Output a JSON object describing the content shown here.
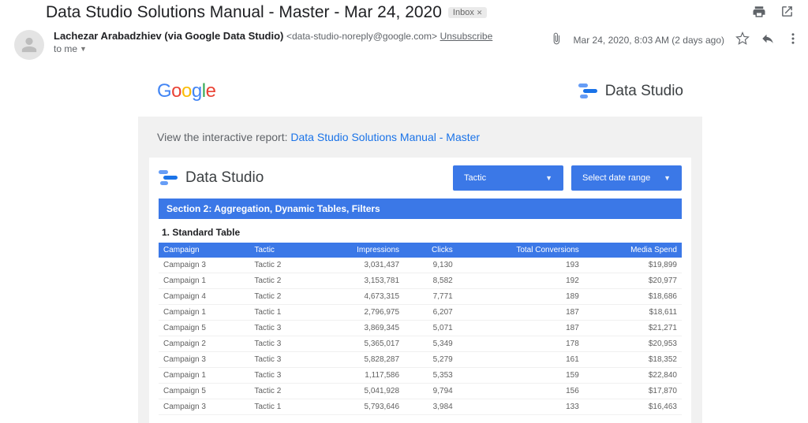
{
  "gmail": {
    "subject": "Data Studio Solutions Manual - Master - Mar 24, 2020",
    "inbox_chip": "Inbox",
    "sender_name": "Lachezar Arabadzhiev (via Google Data Studio)",
    "sender_email": "<data-studio-noreply@google.com>",
    "unsubscribe": "Unsubscribe",
    "to_line": "to me",
    "timestamp": "Mar 24, 2020, 8:03 AM (2 days ago)"
  },
  "ds": {
    "brand": "Data Studio",
    "intro_prefix": "View the interactive report: ",
    "intro_link": "Data Studio Solutions Manual - Master",
    "control_tactic": "Tactic",
    "control_date": "Select date range",
    "section_bar": "Section 2: Aggregation, Dynamic Tables, Filters",
    "table_title": "1. Standard Table",
    "columns": [
      "Campaign",
      "Tactic",
      "Impressions",
      "Clicks",
      "Total Conversions",
      "Media Spend"
    ],
    "rows": [
      [
        "Campaign 3",
        "Tactic 2",
        "3,031,437",
        "9,130",
        "193",
        "$19,899"
      ],
      [
        "Campaign 1",
        "Tactic 2",
        "3,153,781",
        "8,582",
        "192",
        "$20,977"
      ],
      [
        "Campaign 4",
        "Tactic 2",
        "4,673,315",
        "7,771",
        "189",
        "$18,686"
      ],
      [
        "Campaign 1",
        "Tactic 1",
        "2,796,975",
        "6,207",
        "187",
        "$18,611"
      ],
      [
        "Campaign 5",
        "Tactic 3",
        "3,869,345",
        "5,071",
        "187",
        "$21,271"
      ],
      [
        "Campaign 2",
        "Tactic 3",
        "5,365,017",
        "5,349",
        "178",
        "$20,953"
      ],
      [
        "Campaign 3",
        "Tactic 3",
        "5,828,287",
        "5,279",
        "161",
        "$18,352"
      ],
      [
        "Campaign 1",
        "Tactic 3",
        "1,117,586",
        "5,353",
        "159",
        "$22,840"
      ],
      [
        "Campaign 5",
        "Tactic 2",
        "5,041,928",
        "9,794",
        "156",
        "$17,870"
      ],
      [
        "Campaign 3",
        "Tactic 1",
        "5,793,646",
        "3,984",
        "133",
        "$16,463"
      ]
    ]
  }
}
